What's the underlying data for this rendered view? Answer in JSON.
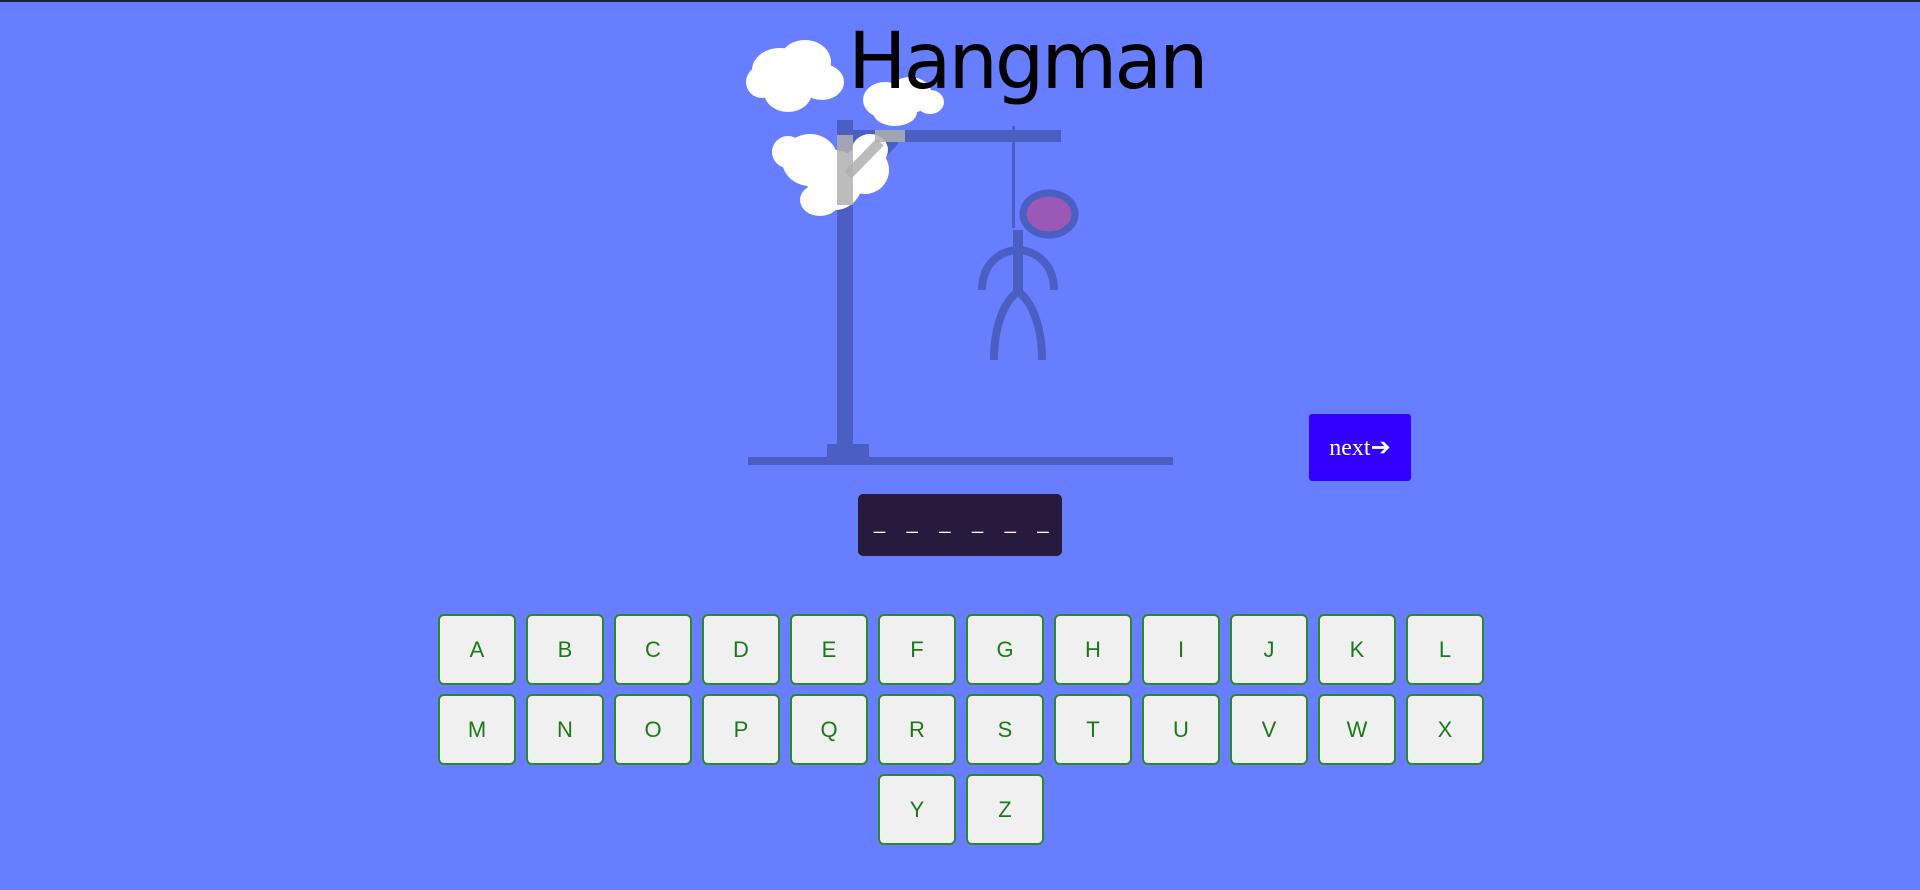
{
  "game": {
    "title": "Hangman",
    "word_display": "_ _ _ _ _ _",
    "next_label": "next➔"
  },
  "colors": {
    "background": "#667eff",
    "gallows": "#4a5fc1",
    "head_fill": "#9b59b6",
    "next_button": "#3300ff",
    "word_box": "#281a3c",
    "key_text": "#1a7a1a",
    "key_border": "#2a8a2a"
  },
  "keyboard": {
    "rows": [
      [
        "A",
        "B",
        "C",
        "D",
        "E",
        "F",
        "G",
        "H",
        "I",
        "J",
        "K",
        "L"
      ],
      [
        "M",
        "N",
        "O",
        "P",
        "Q",
        "R",
        "S",
        "T",
        "U",
        "V",
        "W",
        "X"
      ],
      [
        "Y",
        "Z"
      ]
    ]
  }
}
